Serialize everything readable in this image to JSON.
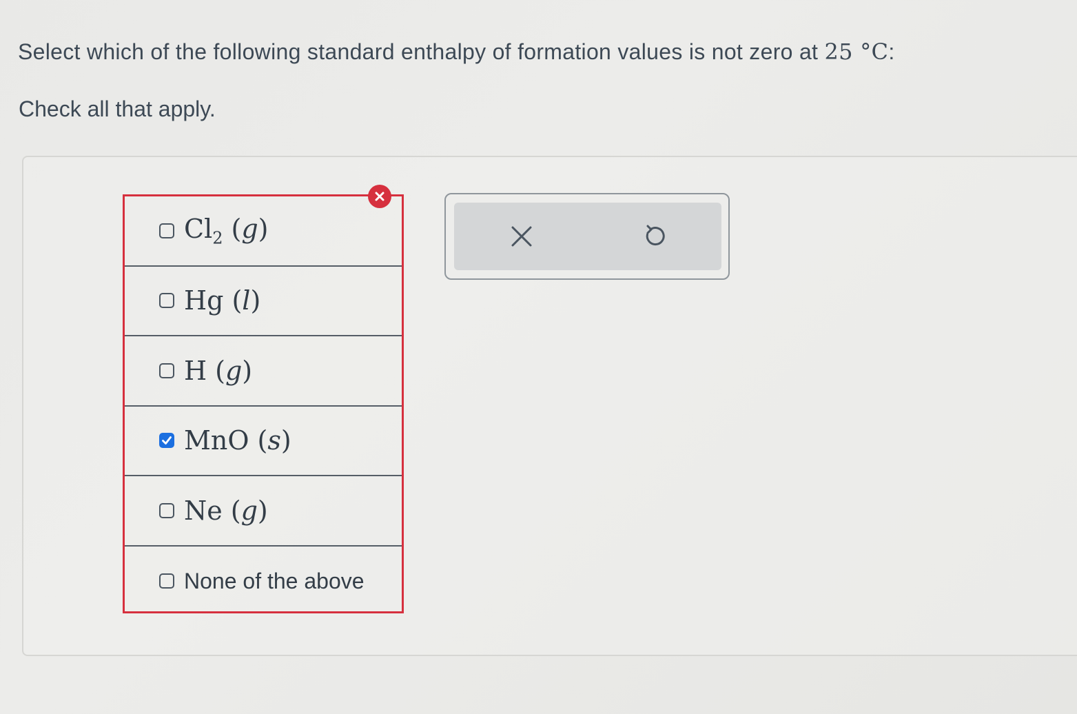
{
  "question": {
    "text_before": "Select which of the following standard enthalpy of formation values is not zero at ",
    "temperature": "25 °C",
    "colon": ":"
  },
  "instruction": "Check all that apply.",
  "options": [
    {
      "formula": "Cl",
      "subscript": "2",
      "phase": "g",
      "checked": false
    },
    {
      "formula": "Hg",
      "subscript": "",
      "phase": "l",
      "checked": false
    },
    {
      "formula": "H",
      "subscript": "",
      "phase": "g",
      "checked": false
    },
    {
      "formula": "MnO",
      "subscript": "",
      "phase": "s",
      "checked": true
    },
    {
      "formula": "Ne",
      "subscript": "",
      "phase": "g",
      "checked": false
    },
    {
      "label": "None of the above",
      "checked": false
    }
  ],
  "status": {
    "result": "incorrect",
    "error_icon": "x-circle-icon",
    "error_color": "#d6303e"
  },
  "tools": {
    "clear_icon": "x-icon",
    "undo_icon": "undo-icon"
  },
  "colors": {
    "checkbox_checked": "#1b6fe0",
    "text": "#3d4955"
  }
}
